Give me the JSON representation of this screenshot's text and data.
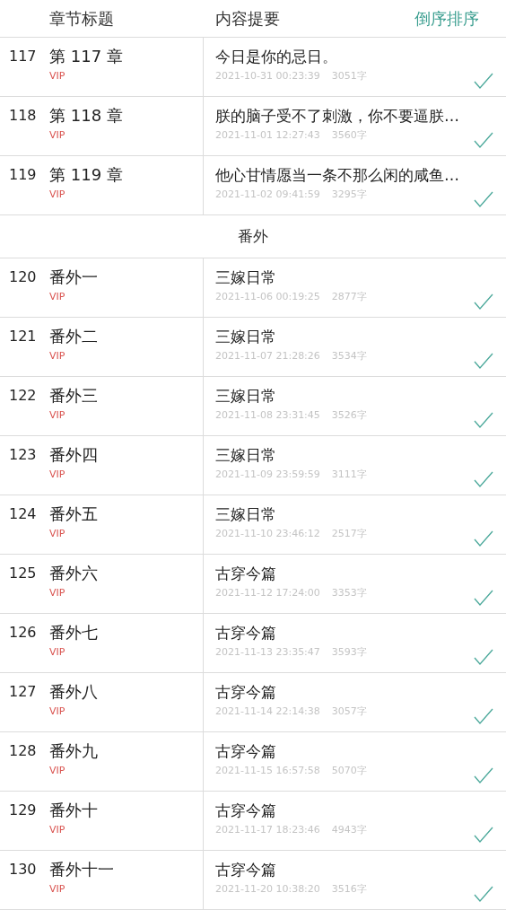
{
  "header": {
    "title_column": "章节标题",
    "summary_column": "内容提要",
    "sort_button": "倒序排序"
  },
  "sections": [
    {
      "chapters": [
        {
          "number": "117",
          "title": "第 117 章",
          "badge": "VIP",
          "summary": "今日是你的忌日。",
          "time": "2021-10-31 00:23:39",
          "words": "3051字",
          "read": true
        },
        {
          "number": "118",
          "title": "第 118 章",
          "badge": "VIP",
          "summary": "朕的脑子受不了刺激，你不要逼朕…",
          "time": "2021-11-01 12:27:43",
          "words": "3560字",
          "read": true
        },
        {
          "number": "119",
          "title": "第 119 章",
          "badge": "VIP",
          "summary": "他心甘情愿当一条不那么闲的咸鱼…",
          "time": "2021-11-02 09:41:59",
          "words": "3295字",
          "read": true
        }
      ]
    },
    {
      "heading": "番外",
      "chapters": [
        {
          "number": "120",
          "title": "番外一",
          "badge": "VIP",
          "summary": "三嫁日常",
          "time": "2021-11-06 00:19:25",
          "words": "2877字",
          "read": true
        },
        {
          "number": "121",
          "title": "番外二",
          "badge": "VIP",
          "summary": "三嫁日常",
          "time": "2021-11-07 21:28:26",
          "words": "3534字",
          "read": true
        },
        {
          "number": "122",
          "title": "番外三",
          "badge": "VIP",
          "summary": "三嫁日常",
          "time": "2021-11-08 23:31:45",
          "words": "3526字",
          "read": true
        },
        {
          "number": "123",
          "title": "番外四",
          "badge": "VIP",
          "summary": "三嫁日常",
          "time": "2021-11-09 23:59:59",
          "words": "3111字",
          "read": true
        },
        {
          "number": "124",
          "title": "番外五",
          "badge": "VIP",
          "summary": "三嫁日常",
          "time": "2021-11-10 23:46:12",
          "words": "2517字",
          "read": true
        },
        {
          "number": "125",
          "title": "番外六",
          "badge": "VIP",
          "summary": "古穿今篇",
          "time": "2021-11-12 17:24:00",
          "words": "3353字",
          "read": true
        },
        {
          "number": "126",
          "title": "番外七",
          "badge": "VIP",
          "summary": "古穿今篇",
          "time": "2021-11-13 23:35:47",
          "words": "3593字",
          "read": true
        },
        {
          "number": "127",
          "title": "番外八",
          "badge": "VIP",
          "summary": "古穿今篇",
          "time": "2021-11-14 22:14:38",
          "words": "3057字",
          "read": true
        },
        {
          "number": "128",
          "title": "番外九",
          "badge": "VIP",
          "summary": "古穿今篇",
          "time": "2021-11-15 16:57:58",
          "words": "5070字",
          "read": true
        },
        {
          "number": "129",
          "title": "番外十",
          "badge": "VIP",
          "summary": "古穿今篇",
          "time": "2021-11-17 18:23:46",
          "words": "4943字",
          "read": true
        },
        {
          "number": "130",
          "title": "番外十一",
          "badge": "VIP",
          "summary": "古穿今篇",
          "time": "2021-11-20 10:38:20",
          "words": "3516字",
          "read": true
        }
      ]
    }
  ]
}
